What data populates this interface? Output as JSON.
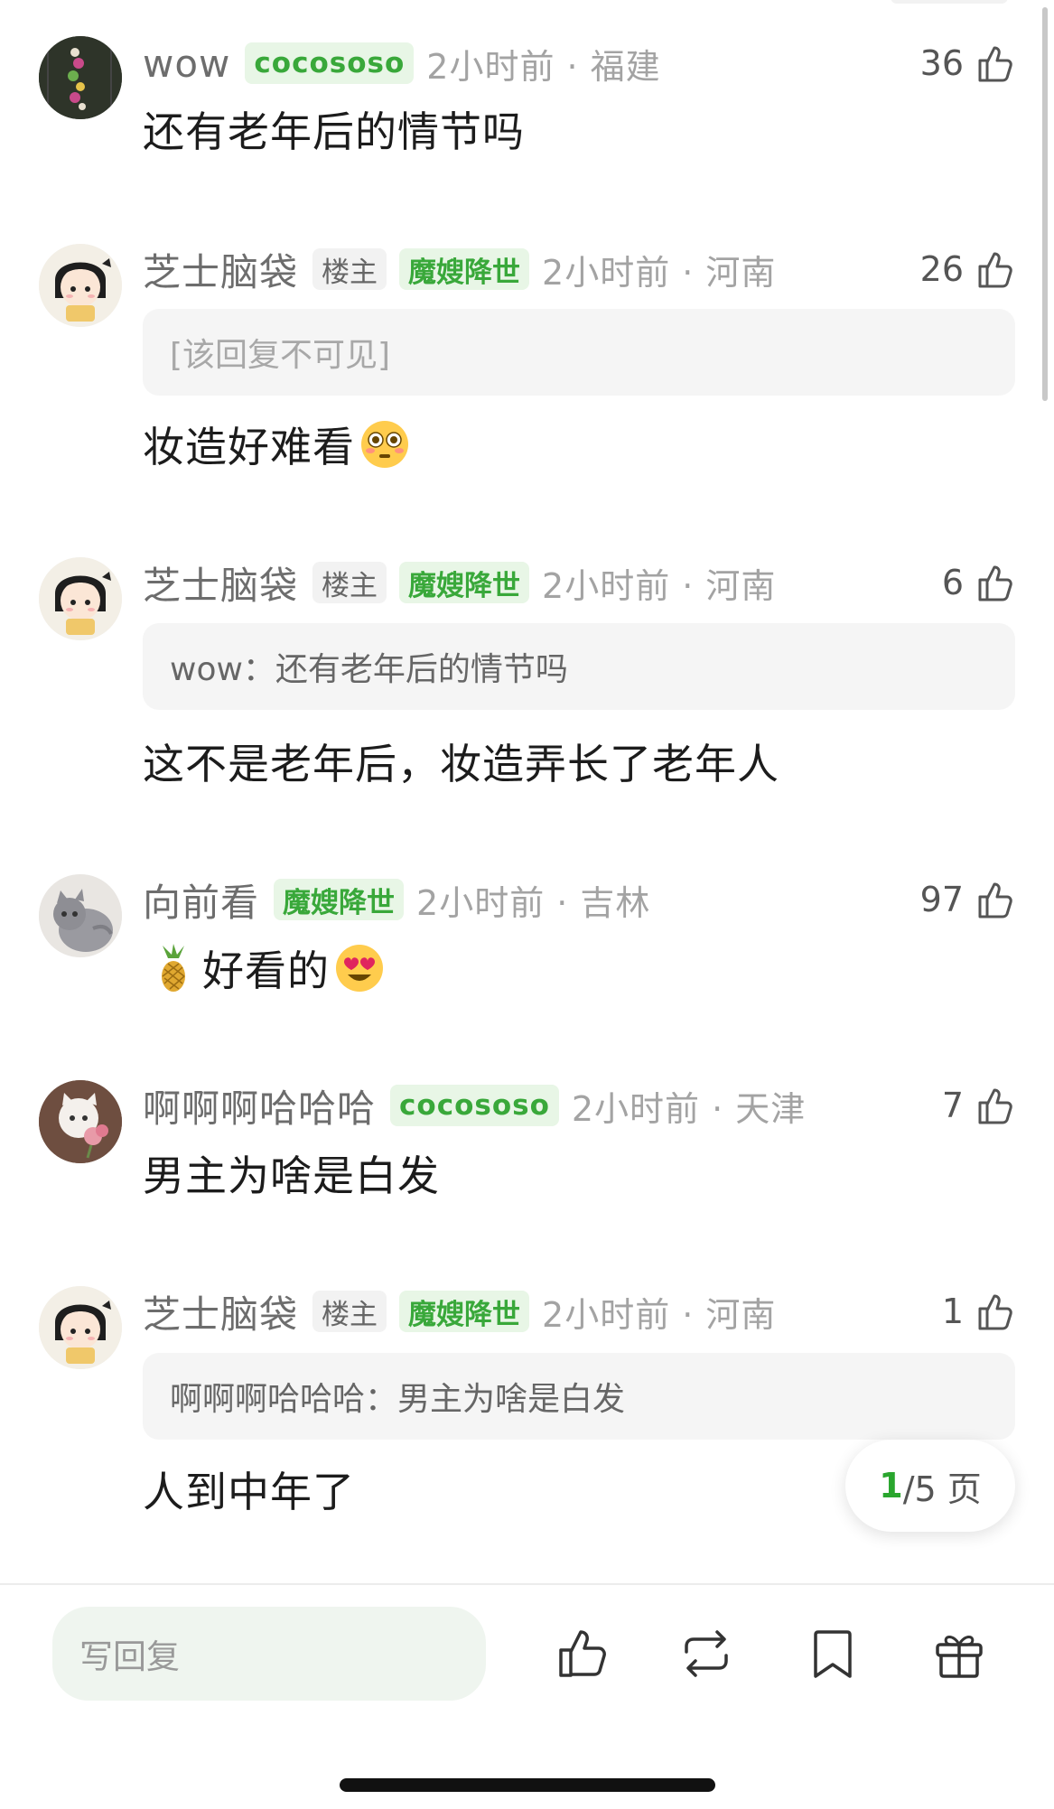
{
  "comments": [
    {
      "username": "wow",
      "badges": [
        {
          "text": "cocososo",
          "kind": "coco"
        }
      ],
      "time_location": "2小时前 · 福建",
      "likes": "36",
      "quote": null,
      "text": "还有老年后的情节吗"
    },
    {
      "username": "芝士脑袋",
      "badges": [
        {
          "text": "楼主",
          "kind": "host"
        },
        {
          "text": "魔嫂降世",
          "kind": "green"
        }
      ],
      "time_location": "2小时前 · 河南",
      "likes": "26",
      "quote": "[该回复不可见]",
      "text": "妆造好难看"
    },
    {
      "username": "芝士脑袋",
      "badges": [
        {
          "text": "楼主",
          "kind": "host"
        },
        {
          "text": "魔嫂降世",
          "kind": "green"
        }
      ],
      "time_location": "2小时前 · 河南",
      "likes": "6",
      "quote": "wow：还有老年后的情节吗",
      "text": "这不是老年后，妆造弄长了老年人"
    },
    {
      "username": "向前看",
      "badges": [
        {
          "text": "魔嫂降世",
          "kind": "green"
        }
      ],
      "time_location": "2小时前 · 吉林",
      "likes": "97",
      "quote": null,
      "text": "好看的"
    },
    {
      "username": "啊啊啊哈哈哈",
      "badges": [
        {
          "text": "cocososo",
          "kind": "coco"
        }
      ],
      "time_location": "2小时前 · 天津",
      "likes": "7",
      "quote": null,
      "text": "男主为啥是白发"
    },
    {
      "username": "芝士脑袋",
      "badges": [
        {
          "text": "楼主",
          "kind": "host"
        },
        {
          "text": "魔嫂降世",
          "kind": "green"
        }
      ],
      "time_location": "2小时前 · 河南",
      "likes": "1",
      "quote": "啊啊啊哈哈哈：男主为啥是白发",
      "text": "人到中年了"
    }
  ],
  "emojis": {
    "comment_2": "flushed-face",
    "comment_4_lead": "pineapple",
    "comment_4_trail": "heart-eyes-face"
  },
  "pagination": {
    "current": "1",
    "rest": "/5 页"
  },
  "bottom_bar": {
    "reply_placeholder": "写回复",
    "icons": [
      "thumbs-up-icon",
      "repost-icon",
      "bookmark-icon",
      "gift-icon"
    ]
  },
  "colors": {
    "accent_green": "#39a83a",
    "badge_green_bg": "#e8f6e6",
    "page_current": "#2aa62e"
  }
}
